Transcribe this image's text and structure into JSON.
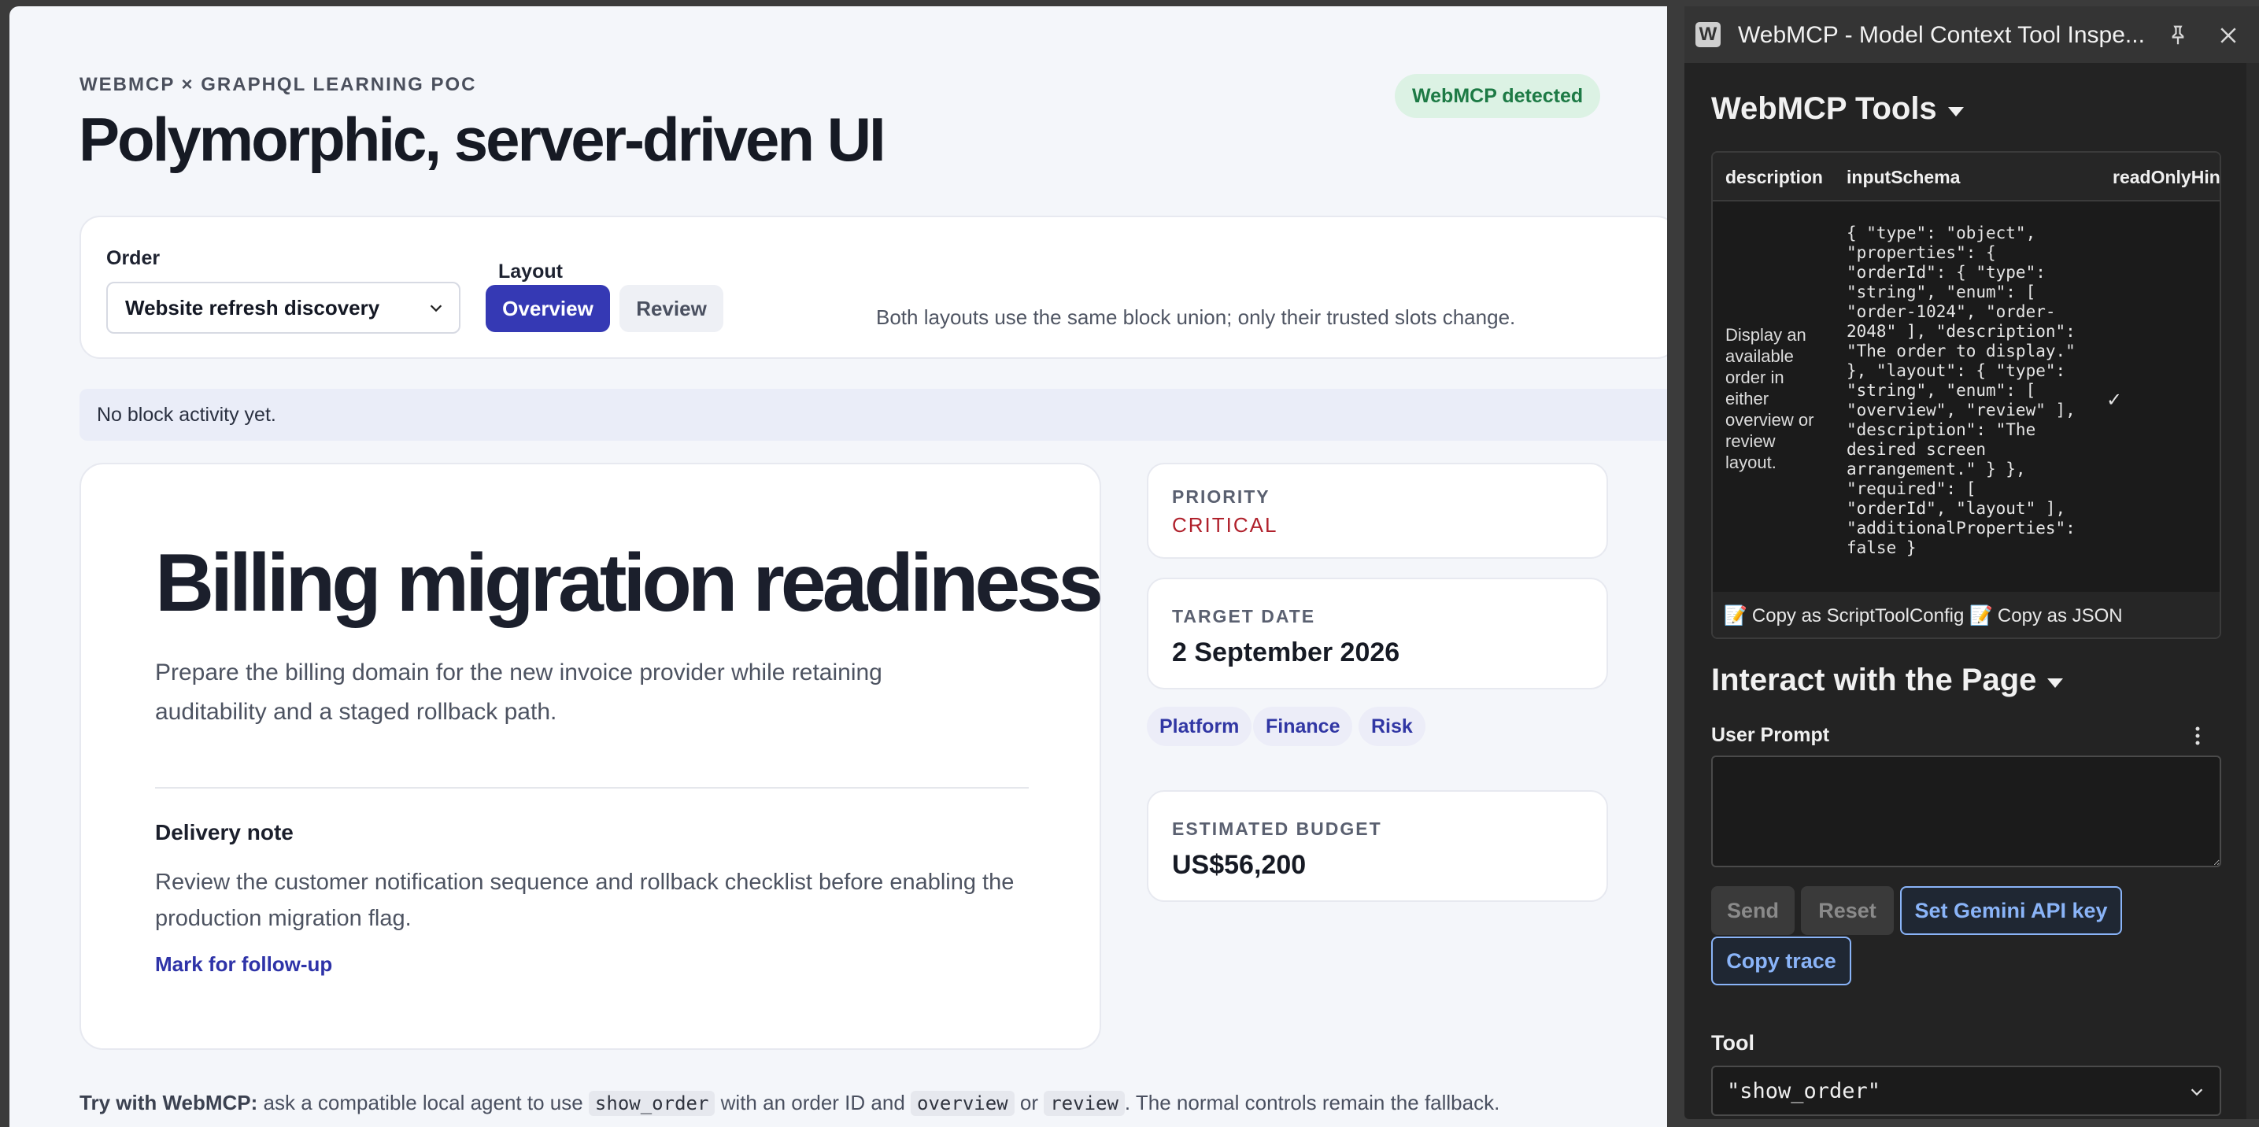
{
  "app": {
    "eyebrow": "WEBMCP × GRAPHQL LEARNING POC",
    "title": "Polymorphic, server-driven UI",
    "status_pill": "WebMCP detected"
  },
  "controls": {
    "order_label": "Order",
    "order_value": "Website refresh discovery",
    "layout_label": "Layout",
    "layout_options": [
      "Overview",
      "Review"
    ],
    "layout_selected": "Overview",
    "note": "Both layouts use the same block union; only their trusted slots change."
  },
  "activity": "No block activity yet.",
  "block": {
    "title": "Billing migration readiness",
    "description": "Prepare the billing domain for the new invoice provider while retaining auditability and a staged rollback path.",
    "note_heading": "Delivery note",
    "note_text": "Review the customer notification sequence and rollback checklist before enabling the production migration flag.",
    "followup_link": "Mark for follow-up"
  },
  "side": {
    "priority_label": "PRIORITY",
    "priority_value": "CRITICAL",
    "target_label": "TARGET DATE",
    "target_value": "2 September 2026",
    "tags": [
      "Platform",
      "Finance",
      "Risk"
    ],
    "budget_label": "ESTIMATED BUDGET",
    "budget_value": "US$56,200"
  },
  "hint": {
    "lead": "Try with WebMCP:",
    "part1": "ask a compatible local agent to use",
    "code1": "show_order",
    "part2": "with an order ID and",
    "code2": "overview",
    "part3": "or",
    "code3": "review",
    "part4": ". The normal controls remain the fallback."
  },
  "extension": {
    "window_title": "WebMCP - Model Context Tool Inspe...",
    "logo_letter": "W",
    "tools_heading": "WebMCP Tools",
    "table_headers": [
      "description",
      "inputSchema",
      "readOnlyHin"
    ],
    "tool_description": "Display an available order in either overview or review layout.",
    "tool_schema": "{ \"type\": \"object\",\n\"properties\": {\n\"orderId\": { \"type\":\n\"string\", \"enum\": [\n\"order-1024\", \"order-\n2048\" ], \"description\":\n\"The order to display.\"\n}, \"layout\": { \"type\":\n\"string\", \"enum\": [\n\"overview\", \"review\" ],\n\"description\": \"The\ndesired screen\narrangement.\" } },\n\"required\": [\n\"orderId\", \"layout\" ],\n\"additionalProperties\":\nfalse }",
    "readonly_value": "✓",
    "copy_script": "Copy as ScriptToolConfig",
    "copy_json": "Copy as JSON",
    "interact_heading": "Interact with the Page",
    "prompt_label": "User Prompt",
    "prompt_value": "",
    "send_label": "Send",
    "reset_label": "Reset",
    "api_key_label": "Set Gemini API key",
    "copy_trace_label": "Copy trace",
    "tool_label": "Tool",
    "tool_value": "\"show_order\""
  },
  "colors": {
    "accent": "#3539b4",
    "success": "#1d7a45",
    "critical": "#b0212c",
    "panel_bg": "#232323",
    "link_blue": "#8ab4f8"
  }
}
